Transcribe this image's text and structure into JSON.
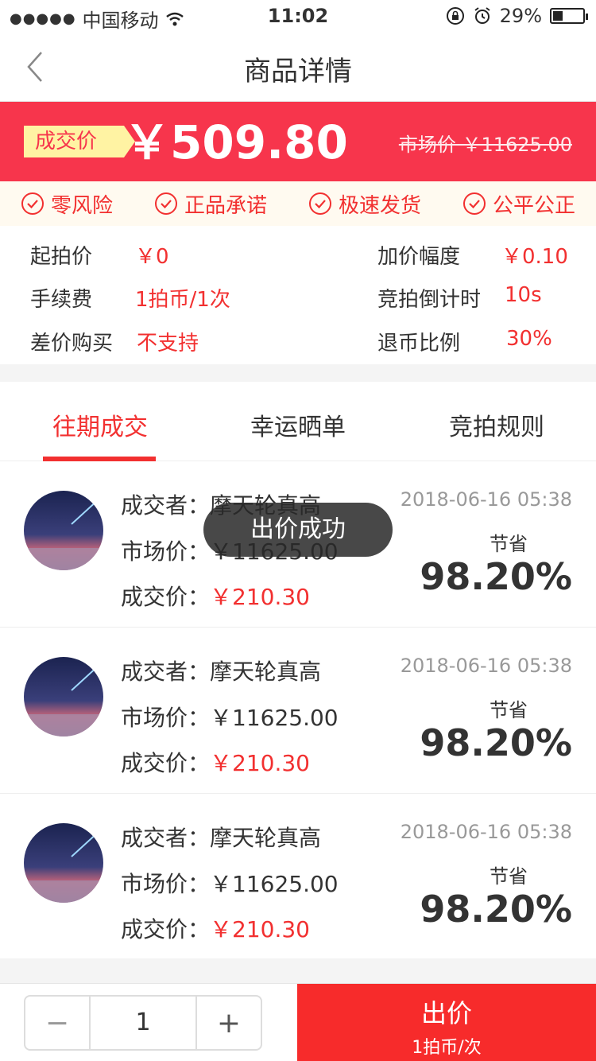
{
  "status": {
    "carrier": "中国移动",
    "time": "11:02",
    "battery": "29%"
  },
  "nav": {
    "title": "商品详情"
  },
  "banner": {
    "deal_tag": "成交价",
    "deal_price": "￥509.80",
    "market_price": "市场价 ￥11625.00"
  },
  "guarantees": [
    "零风险",
    "正品承诺",
    "极速发货",
    "公平公正"
  ],
  "params": {
    "start_price_k": "起拍价",
    "start_price_v": "￥0",
    "increment_k": "加价幅度",
    "increment_v": "￥0.10",
    "fee_k": "手续费",
    "fee_v": "1拍币/1次",
    "countdown_k": "竞拍倒计时",
    "countdown_v": "10s",
    "diff_buy_k": "差价购买",
    "diff_buy_v": "不支持",
    "refund_k": "退币比例",
    "refund_v": "30%"
  },
  "tabs": [
    "往期成交",
    "幸运晒单",
    "竞拍规则"
  ],
  "records": [
    {
      "buyer_label": "成交者：",
      "buyer": "摩天轮真高",
      "market_label": "市场价：",
      "market": "￥11625.00",
      "deal_label": "成交价：",
      "deal": "￥210.30",
      "time": "2018-06-16 05:38",
      "save_label": "节省",
      "save": "98.20%"
    },
    {
      "buyer_label": "成交者：",
      "buyer": "摩天轮真高",
      "market_label": "市场价：",
      "market": "￥11625.00",
      "deal_label": "成交价：",
      "deal": "￥210.30",
      "time": "2018-06-16 05:38",
      "save_label": "节省",
      "save": "98.20%"
    },
    {
      "buyer_label": "成交者：",
      "buyer": "摩天轮真高",
      "market_label": "市场价：",
      "market": "￥11625.00",
      "deal_label": "成交价：",
      "deal": "￥210.30",
      "time": "2018-06-16 05:38",
      "save_label": "节省",
      "save": "98.20%"
    }
  ],
  "toast": "出价成功",
  "bottom": {
    "minus": "−",
    "quantity": "1",
    "plus": "+",
    "bid_label": "出价",
    "bid_sub": "1拍币/次"
  },
  "colors": {
    "accent": "#f23030",
    "banner": "#f7354c",
    "tag_bg": "#fff3a3"
  }
}
